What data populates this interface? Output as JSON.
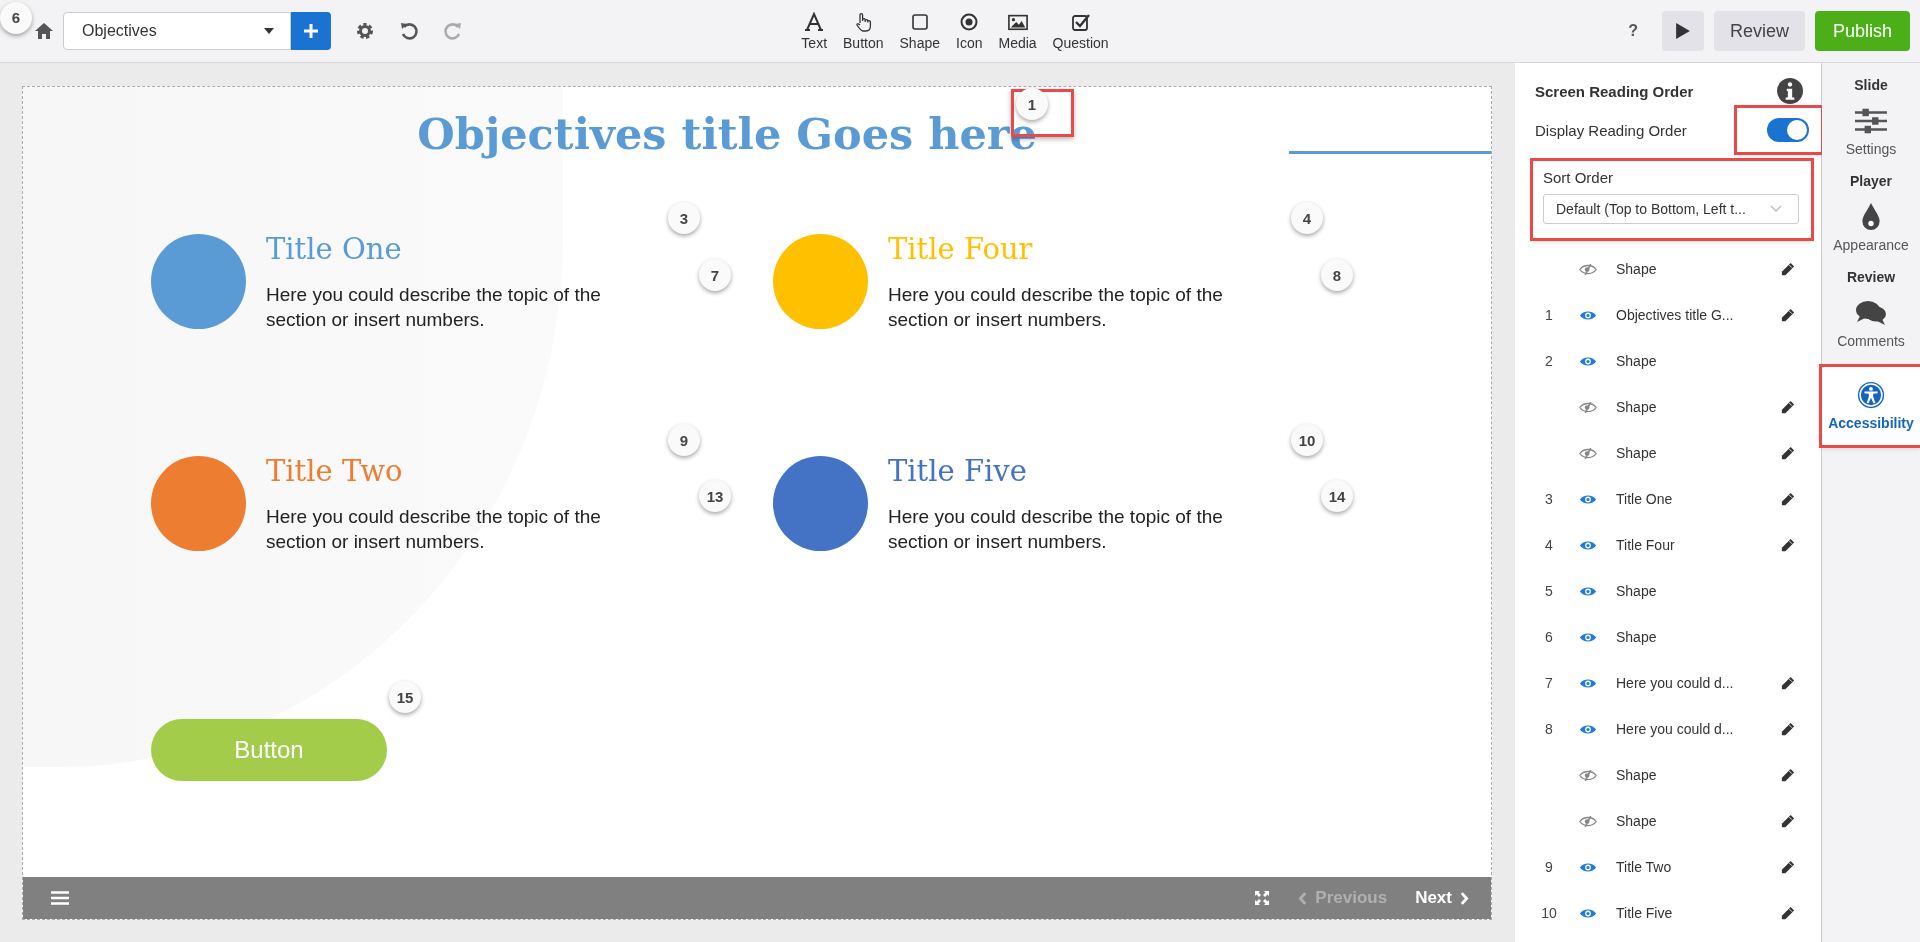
{
  "toolbar": {
    "home_badge": "6",
    "page_select": {
      "value": "Objectives"
    },
    "insert_tools": [
      {
        "kind": "text",
        "label": "Text"
      },
      {
        "kind": "button",
        "label": "Button"
      },
      {
        "kind": "shape",
        "label": "Shape"
      },
      {
        "kind": "icon",
        "label": "Icon"
      },
      {
        "kind": "media",
        "label": "Media"
      },
      {
        "kind": "question",
        "label": "Question"
      }
    ],
    "help": "?",
    "review_button": "Review",
    "publish_button": "Publish"
  },
  "slide": {
    "title": "Objectives title Goes here",
    "items": [
      {
        "title": "Title One",
        "description": "Here you could describe the topic of the section or insert numbers.",
        "color": "#5b9bd5"
      },
      {
        "title": "Title Four",
        "description": "Here you could describe the topic of the section or insert numbers.",
        "color": "#ffc000"
      },
      {
        "title": "Title Two",
        "description": "Here you could describe the topic of the section or insert numbers.",
        "color": "#ed7d31"
      },
      {
        "title": "Title Five",
        "description": "Here you could describe the topic of the section or insert numbers.",
        "color": "#4472c4"
      }
    ],
    "button": "Button",
    "order_badges": [
      {
        "label": "1",
        "highlighted": true
      },
      {
        "label": "3",
        "highlighted": false
      },
      {
        "label": "4",
        "highlighted": false
      },
      {
        "label": "7",
        "highlighted": false
      },
      {
        "label": "8",
        "highlighted": false
      },
      {
        "label": "9",
        "highlighted": false
      },
      {
        "label": "10",
        "highlighted": false
      },
      {
        "label": "13",
        "highlighted": false
      },
      {
        "label": "14",
        "highlighted": false
      },
      {
        "label": "15",
        "highlighted": false
      }
    ],
    "footer": {
      "previous": "Previous",
      "previous_disabled": true,
      "next": "Next",
      "next_disabled": false
    }
  },
  "reading_order_panel": {
    "title": "Screen Reading Order",
    "display_toggle": {
      "label": "Display Reading Order",
      "on": true,
      "highlighted": true
    },
    "sort_order": {
      "label": "Sort Order",
      "value": "Default (Top to Bottom, Left t...",
      "highlighted": true
    },
    "rows": [
      {
        "number": "",
        "label": "Shape",
        "visible": false,
        "editable": true
      },
      {
        "number": "1",
        "label": "Objectives title G...",
        "visible": true,
        "editable": true
      },
      {
        "number": "2",
        "label": "Shape",
        "visible": true,
        "editable": false
      },
      {
        "number": "",
        "label": "Shape",
        "visible": false,
        "editable": true
      },
      {
        "number": "",
        "label": "Shape",
        "visible": false,
        "editable": true
      },
      {
        "number": "3",
        "label": "Title One",
        "visible": true,
        "editable": true
      },
      {
        "number": "4",
        "label": "Title Four",
        "visible": true,
        "editable": true
      },
      {
        "number": "5",
        "label": "Shape",
        "visible": true,
        "editable": false
      },
      {
        "number": "6",
        "label": "Shape",
        "visible": true,
        "editable": false
      },
      {
        "number": "7",
        "label": "Here you could d...",
        "visible": true,
        "editable": true
      },
      {
        "number": "8",
        "label": "Here you could d...",
        "visible": true,
        "editable": true
      },
      {
        "number": "",
        "label": "Shape",
        "visible": false,
        "editable": true
      },
      {
        "number": "",
        "label": "Shape",
        "visible": false,
        "editable": true
      },
      {
        "number": "9",
        "label": "Title Two",
        "visible": true,
        "editable": true
      },
      {
        "number": "10",
        "label": "Title Five",
        "visible": true,
        "editable": true
      }
    ]
  },
  "side_nav": [
    {
      "kind": "header",
      "label": "Slide"
    },
    {
      "kind": "settings",
      "label": "Settings",
      "selected": false,
      "highlighted": false
    },
    {
      "kind": "header",
      "label": "Player"
    },
    {
      "kind": "appearance",
      "label": "Appearance",
      "selected": false,
      "highlighted": false
    },
    {
      "kind": "header",
      "label": "Review"
    },
    {
      "kind": "comments",
      "label": "Comments",
      "selected": false,
      "highlighted": false
    },
    {
      "kind": "accessibility",
      "label": "Accessibility",
      "selected": true,
      "highlighted": true
    }
  ]
}
